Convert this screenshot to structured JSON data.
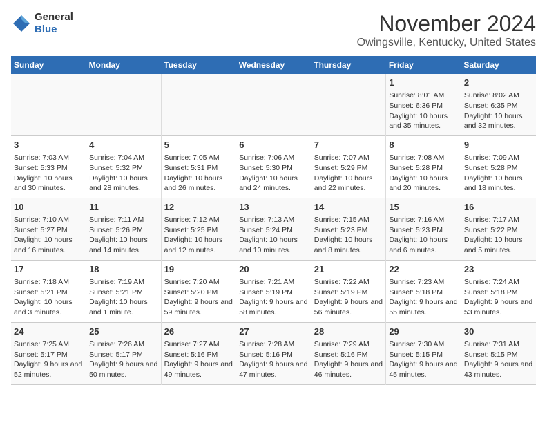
{
  "header": {
    "logo_line1": "General",
    "logo_line2": "Blue",
    "title": "November 2024",
    "subtitle": "Owingsville, Kentucky, United States"
  },
  "weekdays": [
    "Sunday",
    "Monday",
    "Tuesday",
    "Wednesday",
    "Thursday",
    "Friday",
    "Saturday"
  ],
  "weeks": [
    [
      {
        "day": "",
        "content": ""
      },
      {
        "day": "",
        "content": ""
      },
      {
        "day": "",
        "content": ""
      },
      {
        "day": "",
        "content": ""
      },
      {
        "day": "",
        "content": ""
      },
      {
        "day": "1",
        "content": "Sunrise: 8:01 AM\nSunset: 6:36 PM\nDaylight: 10 hours and 35 minutes."
      },
      {
        "day": "2",
        "content": "Sunrise: 8:02 AM\nSunset: 6:35 PM\nDaylight: 10 hours and 32 minutes."
      }
    ],
    [
      {
        "day": "3",
        "content": "Sunrise: 7:03 AM\nSunset: 5:33 PM\nDaylight: 10 hours and 30 minutes."
      },
      {
        "day": "4",
        "content": "Sunrise: 7:04 AM\nSunset: 5:32 PM\nDaylight: 10 hours and 28 minutes."
      },
      {
        "day": "5",
        "content": "Sunrise: 7:05 AM\nSunset: 5:31 PM\nDaylight: 10 hours and 26 minutes."
      },
      {
        "day": "6",
        "content": "Sunrise: 7:06 AM\nSunset: 5:30 PM\nDaylight: 10 hours and 24 minutes."
      },
      {
        "day": "7",
        "content": "Sunrise: 7:07 AM\nSunset: 5:29 PM\nDaylight: 10 hours and 22 minutes."
      },
      {
        "day": "8",
        "content": "Sunrise: 7:08 AM\nSunset: 5:28 PM\nDaylight: 10 hours and 20 minutes."
      },
      {
        "day": "9",
        "content": "Sunrise: 7:09 AM\nSunset: 5:28 PM\nDaylight: 10 hours and 18 minutes."
      }
    ],
    [
      {
        "day": "10",
        "content": "Sunrise: 7:10 AM\nSunset: 5:27 PM\nDaylight: 10 hours and 16 minutes."
      },
      {
        "day": "11",
        "content": "Sunrise: 7:11 AM\nSunset: 5:26 PM\nDaylight: 10 hours and 14 minutes."
      },
      {
        "day": "12",
        "content": "Sunrise: 7:12 AM\nSunset: 5:25 PM\nDaylight: 10 hours and 12 minutes."
      },
      {
        "day": "13",
        "content": "Sunrise: 7:13 AM\nSunset: 5:24 PM\nDaylight: 10 hours and 10 minutes."
      },
      {
        "day": "14",
        "content": "Sunrise: 7:15 AM\nSunset: 5:23 PM\nDaylight: 10 hours and 8 minutes."
      },
      {
        "day": "15",
        "content": "Sunrise: 7:16 AM\nSunset: 5:23 PM\nDaylight: 10 hours and 6 minutes."
      },
      {
        "day": "16",
        "content": "Sunrise: 7:17 AM\nSunset: 5:22 PM\nDaylight: 10 hours and 5 minutes."
      }
    ],
    [
      {
        "day": "17",
        "content": "Sunrise: 7:18 AM\nSunset: 5:21 PM\nDaylight: 10 hours and 3 minutes."
      },
      {
        "day": "18",
        "content": "Sunrise: 7:19 AM\nSunset: 5:21 PM\nDaylight: 10 hours and 1 minute."
      },
      {
        "day": "19",
        "content": "Sunrise: 7:20 AM\nSunset: 5:20 PM\nDaylight: 9 hours and 59 minutes."
      },
      {
        "day": "20",
        "content": "Sunrise: 7:21 AM\nSunset: 5:19 PM\nDaylight: 9 hours and 58 minutes."
      },
      {
        "day": "21",
        "content": "Sunrise: 7:22 AM\nSunset: 5:19 PM\nDaylight: 9 hours and 56 minutes."
      },
      {
        "day": "22",
        "content": "Sunrise: 7:23 AM\nSunset: 5:18 PM\nDaylight: 9 hours and 55 minutes."
      },
      {
        "day": "23",
        "content": "Sunrise: 7:24 AM\nSunset: 5:18 PM\nDaylight: 9 hours and 53 minutes."
      }
    ],
    [
      {
        "day": "24",
        "content": "Sunrise: 7:25 AM\nSunset: 5:17 PM\nDaylight: 9 hours and 52 minutes."
      },
      {
        "day": "25",
        "content": "Sunrise: 7:26 AM\nSunset: 5:17 PM\nDaylight: 9 hours and 50 minutes."
      },
      {
        "day": "26",
        "content": "Sunrise: 7:27 AM\nSunset: 5:16 PM\nDaylight: 9 hours and 49 minutes."
      },
      {
        "day": "27",
        "content": "Sunrise: 7:28 AM\nSunset: 5:16 PM\nDaylight: 9 hours and 47 minutes."
      },
      {
        "day": "28",
        "content": "Sunrise: 7:29 AM\nSunset: 5:16 PM\nDaylight: 9 hours and 46 minutes."
      },
      {
        "day": "29",
        "content": "Sunrise: 7:30 AM\nSunset: 5:15 PM\nDaylight: 9 hours and 45 minutes."
      },
      {
        "day": "30",
        "content": "Sunrise: 7:31 AM\nSunset: 5:15 PM\nDaylight: 9 hours and 43 minutes."
      }
    ]
  ]
}
